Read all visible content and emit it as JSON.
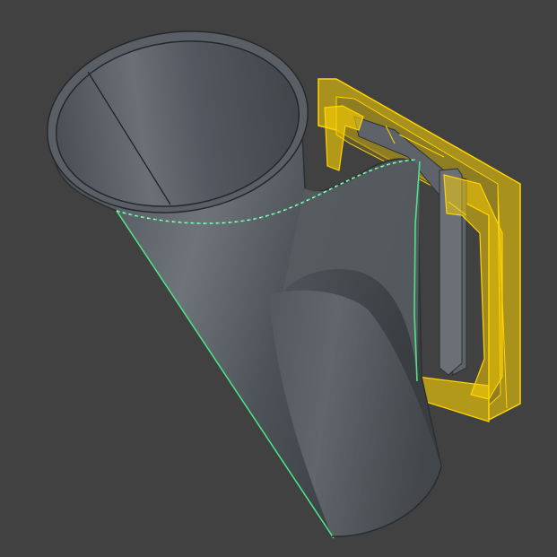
{
  "viewport": {
    "background": "#414141"
  },
  "model": {
    "body_color": "#5a5f64",
    "body_highlight": "#7a8086",
    "body_shadow": "#3d4145",
    "selection_color": "#ffd400",
    "edge_highlight_color": "#4fe08a"
  }
}
